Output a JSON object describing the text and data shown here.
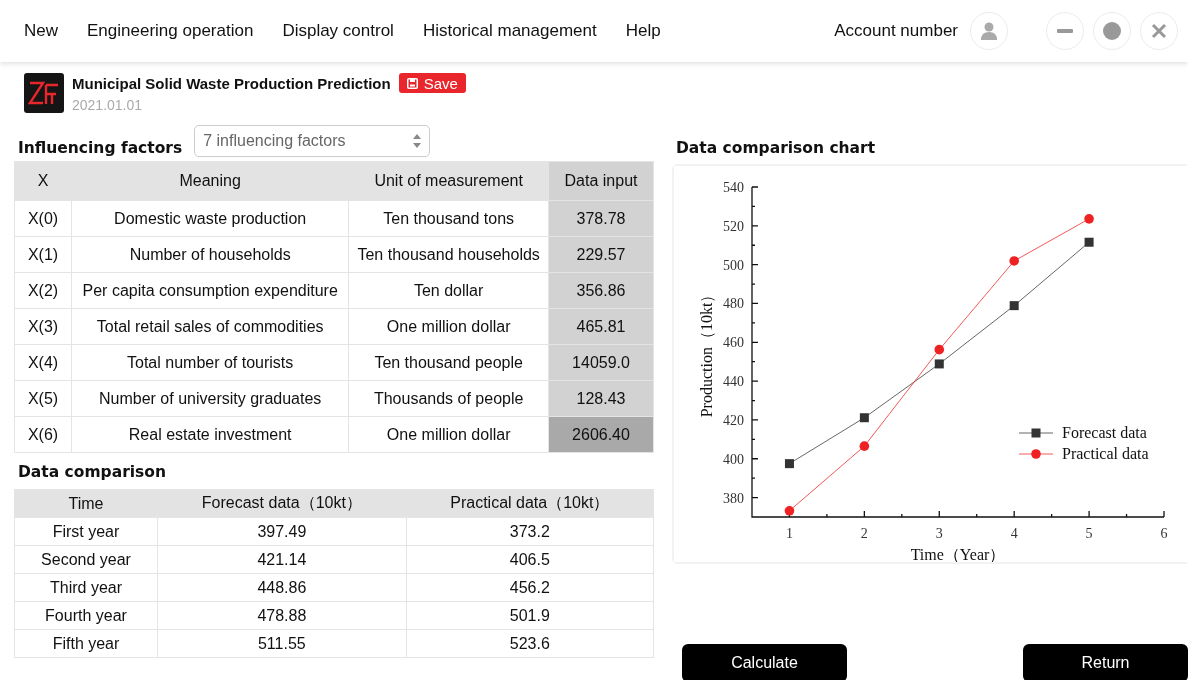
{
  "menu": {
    "items": [
      "New",
      "Engineering operation",
      "Display control",
      "Historical management",
      "Help"
    ],
    "account": "Account number"
  },
  "header": {
    "title": "Municipal Solid Waste Production Prediction",
    "save": "Save",
    "date": "2021.01.01"
  },
  "factors": {
    "label": "Influencing factors",
    "select": "7 influencing factors",
    "columns": [
      "X",
      "Meaning",
      "Unit of measurement",
      "Data input"
    ],
    "rows": [
      {
        "x": "X(0)",
        "meaning": "Domestic waste production",
        "unit": "Ten thousand tons",
        "value": "378.78",
        "selected": false
      },
      {
        "x": "X(1)",
        "meaning": "Number of households",
        "unit": "Ten thousand households",
        "value": "229.57",
        "selected": false
      },
      {
        "x": "X(2)",
        "meaning": "Per capita consumption expenditure",
        "unit": "Ten dollar",
        "value": "356.86",
        "selected": false
      },
      {
        "x": "X(3)",
        "meaning": "Total retail sales of commodities",
        "unit": "One million dollar",
        "value": "465.81",
        "selected": false
      },
      {
        "x": "X(4)",
        "meaning": "Total number of tourists",
        "unit": "Ten thousand people",
        "value": "14059.0",
        "selected": false
      },
      {
        "x": "X(5)",
        "meaning": "Number of university graduates",
        "unit": "Thousands of people",
        "value": "128.43",
        "selected": false
      },
      {
        "x": "X(6)",
        "meaning": "Real estate investment",
        "unit": "One million dollar",
        "value": "2606.40",
        "selected": true
      }
    ]
  },
  "comparison": {
    "label": "Data comparison",
    "columns": [
      "Time",
      "Forecast data（10kt）",
      "Practical data（10kt）"
    ],
    "rows": [
      [
        "First year",
        "397.49",
        "373.2"
      ],
      [
        "Second year",
        "421.14",
        "406.5"
      ],
      [
        "Third year",
        "448.86",
        "456.2"
      ],
      [
        "Fourth year",
        "478.88",
        "501.9"
      ],
      [
        "Fifth year",
        "511.55",
        "523.6"
      ]
    ]
  },
  "chart": {
    "title": "Data comparison chart",
    "chart_data": {
      "type": "line",
      "xlabel": "Time（Year）",
      "ylabel": "Production（10kt）",
      "x": [
        1,
        2,
        3,
        4,
        5
      ],
      "xlim": [
        0.5,
        6
      ],
      "ylim": [
        370,
        540
      ],
      "xticks": [
        1,
        2,
        3,
        4,
        5,
        6
      ],
      "yticks": [
        380,
        400,
        420,
        440,
        460,
        480,
        500,
        520,
        540
      ],
      "legend": true,
      "series": [
        {
          "name": "Forecast data",
          "color": "#333333",
          "marker": "square",
          "values": [
            397.49,
            421.14,
            448.86,
            478.88,
            511.55
          ]
        },
        {
          "name": "Practical data",
          "color": "#ee2222",
          "marker": "circle",
          "values": [
            373.2,
            406.5,
            456.2,
            501.9,
            523.6
          ]
        }
      ]
    }
  },
  "buttons": [
    "Calculate",
    "Return"
  ]
}
